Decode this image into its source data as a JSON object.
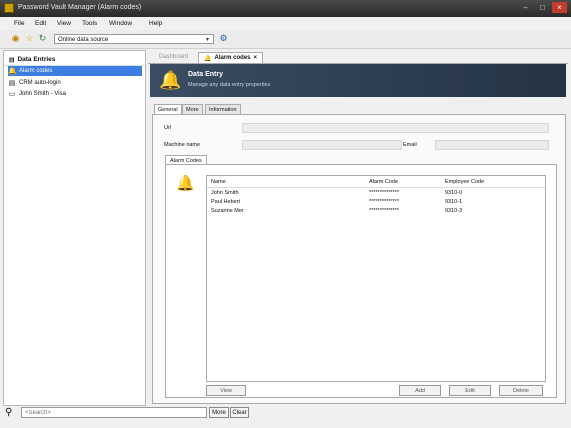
{
  "window": {
    "title": "Password Vault Manager (Alarm codes)"
  },
  "menu": [
    "File",
    "Edit",
    "View",
    "Tools",
    "Window",
    "Help"
  ],
  "toolbar": {
    "datasource": "Online data source"
  },
  "sidebar": {
    "header": "Data Entries",
    "items": [
      {
        "label": "Alarm codes"
      },
      {
        "label": "CRM auto-login"
      },
      {
        "label": "John Smith - Visa"
      }
    ]
  },
  "search": {
    "placeholder": "<Search>",
    "more": "More",
    "clear": "Clear"
  },
  "doc_tabs": [
    {
      "label": "Dashboard"
    },
    {
      "label": "Alarm codes",
      "close": "×"
    }
  ],
  "banner": {
    "title": "Data Entry",
    "subtitle": "Manage any data entry properties"
  },
  "inner_tabs": [
    "General",
    "More",
    "Information"
  ],
  "form": {
    "url_label": "Url",
    "machine_label": "Machine name",
    "email_label": "Email"
  },
  "alarm_group": {
    "tab": "Alarm Codes",
    "columns": [
      "Name",
      "Alarm Code",
      "Employee Code"
    ],
    "rows": [
      {
        "name": "John Smith",
        "code": "**************",
        "emp": "9310-0"
      },
      {
        "name": "Paul Hebert",
        "code": "**************",
        "emp": "9310-1"
      },
      {
        "name": "Suzanne Mer",
        "code": "**************",
        "emp": "9310-3"
      }
    ],
    "buttons": {
      "view": "View",
      "add": "Add",
      "edit": "Edit",
      "delete": "Delete"
    }
  }
}
